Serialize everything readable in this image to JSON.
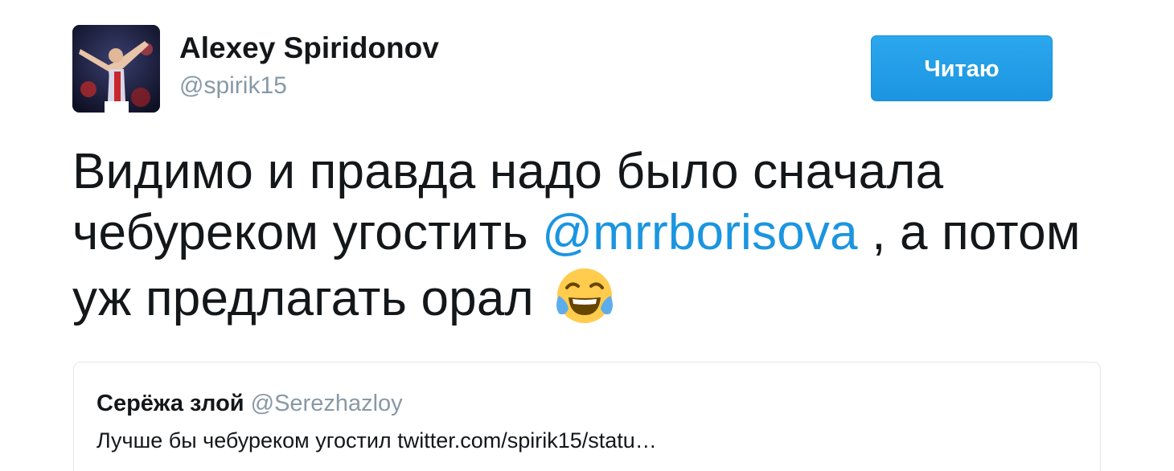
{
  "author": {
    "name": "Alexey Spiridonov",
    "handle": "@spirik15"
  },
  "follow_button": {
    "label": "Читаю"
  },
  "tweet": {
    "text_line1": "Видимо и правда надо было сначала",
    "text_line2_before": "чебуреком угостить ",
    "mention": "@mrrborisova",
    "text_line2_after": " , а потом",
    "text_line3": "уж предлагать орал ",
    "emoji": "face-with-tears-of-joy"
  },
  "quoted_tweet": {
    "name": "Серёжа злой",
    "handle": "@Serezhazloy",
    "text": "Лучше бы чебуреком угостил twitter.com/spirik15/statu…"
  },
  "colors": {
    "accent": "#1da1f2",
    "link": "#1b95e0",
    "text": "#14171a",
    "muted": "#8899a6",
    "border": "#e1e8ed"
  }
}
